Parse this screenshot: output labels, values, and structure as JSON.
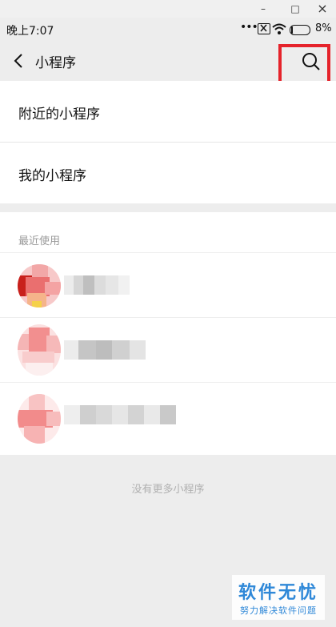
{
  "window": {
    "minimize_glyph": "–",
    "maximize_glyph": "□",
    "close_glyph": "×"
  },
  "status_bar": {
    "time": "晚上7:07",
    "dots": "•••",
    "battery_text": "8%",
    "battery_level": 0.08,
    "icons": [
      "notification-x-icon",
      "wifi-icon",
      "battery-icon"
    ]
  },
  "header": {
    "title": "小程序",
    "back_icon": "chevron-left-icon",
    "search_icon": "search-icon"
  },
  "menu": {
    "items": [
      {
        "label": "附近的小程序"
      },
      {
        "label": "我的小程序"
      }
    ]
  },
  "recent": {
    "title": "最近使用",
    "items": [
      {
        "name": "",
        "icon": "pixelated-app-icon"
      },
      {
        "name": "",
        "icon": "pixelated-app-icon"
      },
      {
        "name": "",
        "icon": "pixelated-app-icon"
      }
    ]
  },
  "footer": {
    "no_more_text": "没有更多小程序"
  },
  "watermark": {
    "main": "软件无忧",
    "sub": "努力解决软件问题"
  },
  "colors": {
    "accent_highlight": "#e5232b",
    "watermark": "#2f88d8",
    "background": "#ededed"
  }
}
